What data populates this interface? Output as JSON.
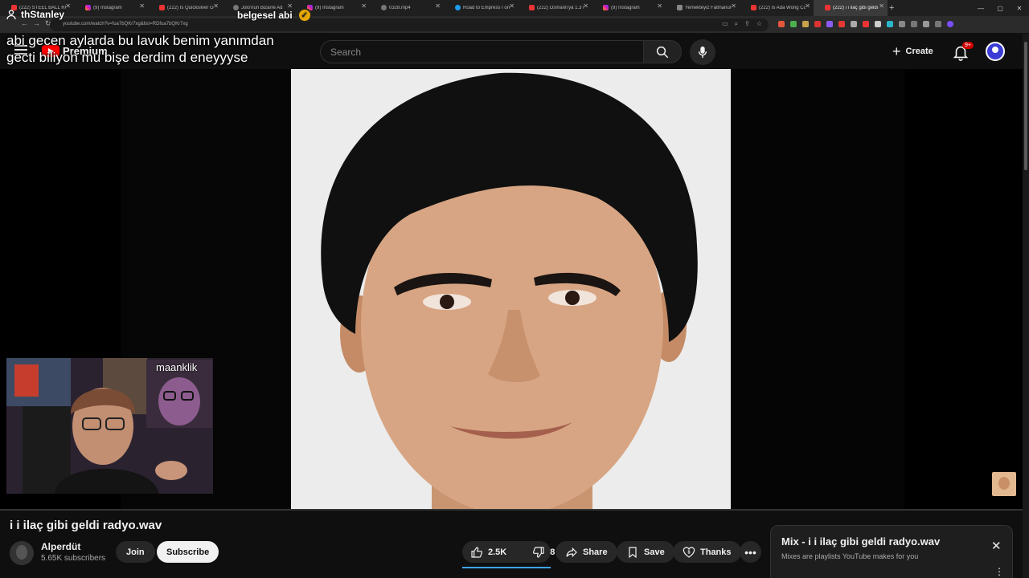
{
  "browser": {
    "tabs": [
      {
        "label": "(222) STEEL BALL RUN",
        "icon": "youtube-favicon"
      },
      {
        "label": "(9) Instagram",
        "icon": "instagram-favicon"
      },
      {
        "label": "(222) Is Quicksilver Go",
        "icon": "youtube-favicon"
      },
      {
        "label": "Jolo'nun Bizarre Ad",
        "icon": "globe-favicon"
      },
      {
        "label": "(9) Instagram",
        "icon": "instagram-favicon"
      },
      {
        "label": "0328.mp4",
        "icon": "globe-favicon"
      },
      {
        "label": "Road to Empress I on",
        "icon": "twitter-favicon"
      },
      {
        "label": "(222) Osmanlı'ya 1.3 M",
        "icon": "youtube-favicon"
      },
      {
        "label": "(9) Instagram",
        "icon": "instagram-favicon"
      },
      {
        "label": "Yemekteyiz Fatmanur",
        "icon": "globe-favicon"
      },
      {
        "label": "(222) Is Ada Wong Co",
        "icon": "youtube-favicon"
      },
      {
        "label": "(222) i i ilaç gibi geldi",
        "icon": "youtube-favicon"
      }
    ],
    "url": "youtube.com/watch?v=fua7bQKr7xg&list=RDfua7bQKr7xg"
  },
  "header": {
    "logo_word": "Premium",
    "search_placeholder": "Search",
    "create_label": "Create",
    "notifications_badge": "9+"
  },
  "overlay": {
    "streamer_name": "thStanley",
    "badge_text": "belgesel abi",
    "message_line1": "abi gecen aylarda bu lavuk benim yanımdan",
    "message_line2": "gecti biliyon mu bişe derdim d eneyyyse",
    "webcam_label": "maanklik"
  },
  "video": {
    "title": "i i ilaç gibi geldi radyo.wav",
    "channel_name": "Alperdüt",
    "subscribers": "5.65K subscribers",
    "join_label": "Join",
    "subscribe_label": "Subscribe",
    "likes": "2.5K",
    "dislikes": "8",
    "share_label": "Share",
    "save_label": "Save",
    "thanks_label": "Thanks"
  },
  "mix": {
    "title": "Mix - i i ilaç gibi geldi radyo.wav",
    "subtitle": "Mixes are playlists YouTube makes for you"
  },
  "colors": {
    "background": "#0f0f0f",
    "accent_red": "#ff0000",
    "like_underline": "#3ea6ff"
  }
}
